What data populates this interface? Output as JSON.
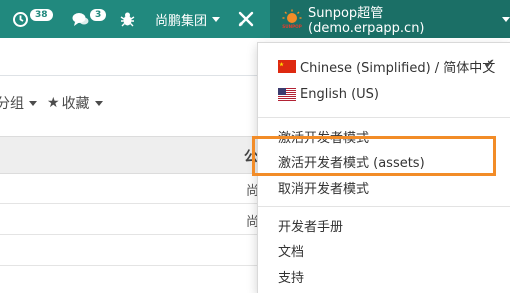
{
  "navbar": {
    "activity_count": "38",
    "message_count": "3",
    "company": "尚鹏集团",
    "user": "Sunpop超管 (demo.erpapp.cn)",
    "logo_text": "SUNPOP"
  },
  "filters": {
    "group_label": "分组",
    "favorites_label": "收藏"
  },
  "table": {
    "header": "公",
    "rows": [
      "尚",
      "尚"
    ]
  },
  "dropdown": {
    "languages": [
      {
        "label": "Chinese (Simplified) / 简体中文",
        "selected": true
      },
      {
        "label": "English (US)",
        "selected": false
      }
    ],
    "dev_mode": {
      "activate": "激活开发者模式",
      "activate_assets": "激活开发者模式 (assets)",
      "deactivate": "取消开发者模式"
    },
    "help": {
      "manual": "开发者手册",
      "docs": "文档",
      "support": "支持"
    }
  },
  "colors": {
    "navbar": "#21897e",
    "highlight": "#f28c28"
  },
  "icons": {
    "activity": "clock-icon",
    "messages": "chat-bubble-icon",
    "debug": "bug-icon",
    "settings": "tools-icon",
    "selected": "check-icon"
  }
}
